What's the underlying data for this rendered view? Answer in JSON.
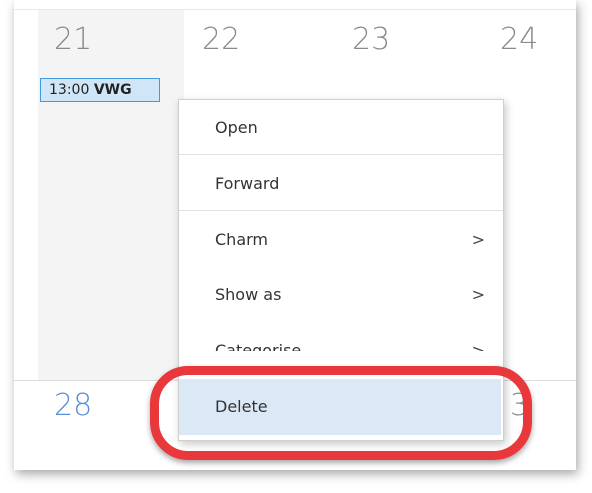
{
  "calendar": {
    "days_top": [
      "21",
      "22",
      "23",
      "24"
    ],
    "day_bottom": "28",
    "partial_day_bottom": "3",
    "event": {
      "time": "13:00",
      "title": "VWG"
    }
  },
  "context_menu": {
    "items": [
      {
        "label": "Open",
        "has_submenu": false
      },
      {
        "label": "Forward",
        "has_submenu": false
      },
      {
        "label": "Charm",
        "has_submenu": true,
        "chevron": ">"
      },
      {
        "label": "Show as",
        "has_submenu": true,
        "chevron": ">"
      },
      {
        "label": "Categorise",
        "has_submenu": true,
        "chevron": ">"
      },
      {
        "label": "Delete",
        "has_submenu": false,
        "highlighted": true
      }
    ]
  },
  "colors": {
    "accent_highlight": "#e8383b",
    "event_fill": "#cfe6f8",
    "event_border": "#3f9ae0",
    "delete_hover": "#dbe9f7"
  }
}
